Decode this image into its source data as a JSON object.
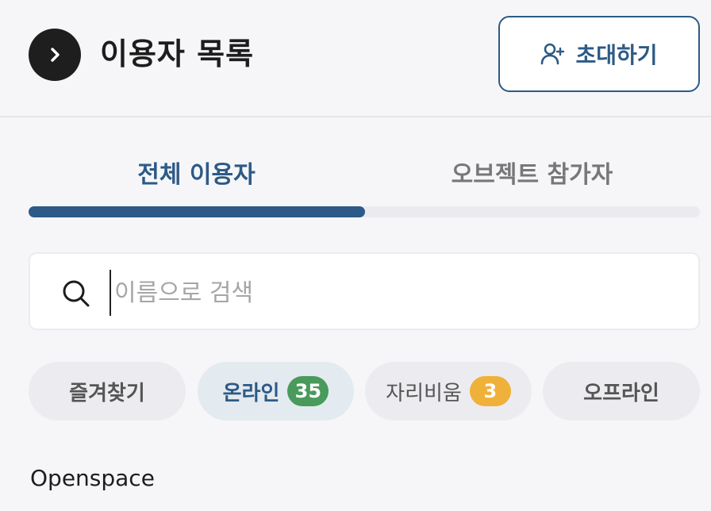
{
  "header": {
    "title": "이용자 목록",
    "invite_label": "초대하기"
  },
  "tabs": [
    {
      "label": "전체 이용자",
      "active": true
    },
    {
      "label": "오브젝트 참가자",
      "active": false
    }
  ],
  "search": {
    "placeholder": "이름으로 검색",
    "value": ""
  },
  "filters": [
    {
      "label": "즐겨찾기"
    },
    {
      "label": "온라인",
      "count": "35",
      "badge_color": "#4a9a5c"
    },
    {
      "label": "자리비움",
      "count": "3",
      "badge_color": "#f0b13a"
    },
    {
      "label": "오프라인"
    }
  ],
  "section": {
    "label": "Openspace"
  },
  "colors": {
    "accent": "#2d5a86",
    "online": "#4a9a5c",
    "away": "#f0b13a"
  },
  "icons": {
    "back": "chevron-right-icon",
    "invite": "user-plus-icon",
    "search": "search-icon"
  }
}
